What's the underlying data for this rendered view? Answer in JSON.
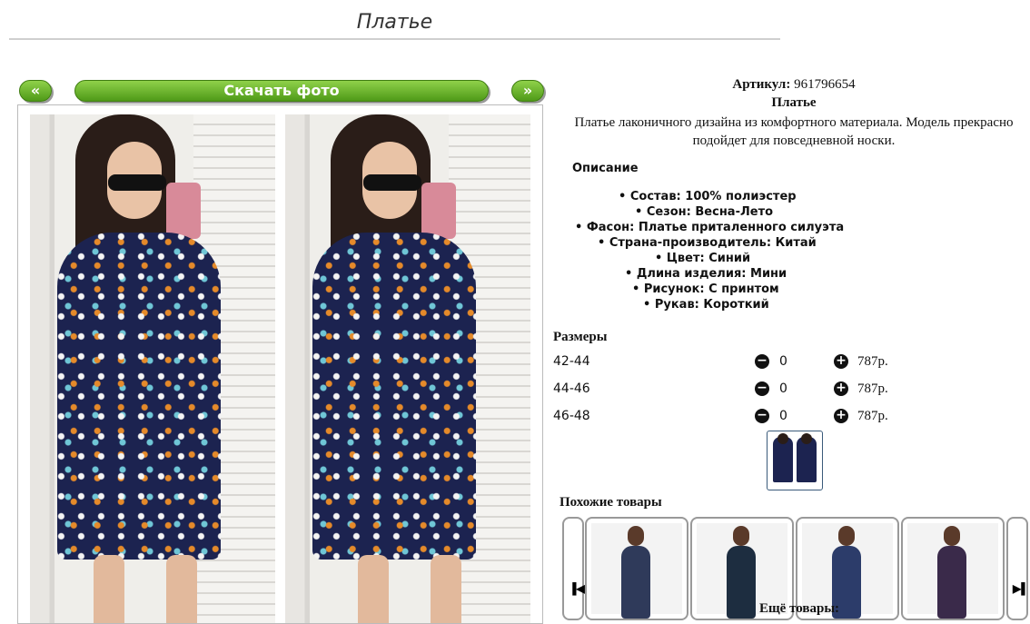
{
  "page": {
    "title": "Платье"
  },
  "gallery": {
    "prev": "«",
    "next": "»",
    "download": "Скачать фото"
  },
  "product": {
    "sku_label": "Артикул:",
    "sku": "961796654",
    "name": "Платье",
    "description": "Платье лаконичного дизайна из комфортного материала. Модель прекрасно подойдет для повседневной носки.",
    "desc_heading": "Описание",
    "properties": [
      "Состав: 100% полиэстер",
      "Сезон: Весна-Лето",
      "Фасон: Платье приталенного силуэта",
      "Страна-производитель: Китай",
      "Цвет: Синий",
      "Длина изделия: Мини",
      "Рисунок: С принтом",
      "Рукав: Короткий"
    ]
  },
  "sizes": {
    "heading": "Размеры",
    "rows": [
      {
        "size": "42-44",
        "qty": "0",
        "price": "787р."
      },
      {
        "size": "44-46",
        "qty": "0",
        "price": "787р."
      },
      {
        "size": "46-48",
        "qty": "0",
        "price": "787р."
      }
    ],
    "minus": "−",
    "plus": "+"
  },
  "similar": {
    "heading": "Похожие товары",
    "prev": "▐◀",
    "next": "▶▌",
    "colors": [
      "#2f3a5a",
      "#1d2d40",
      "#2c3c6a",
      "#3a2a4a"
    ]
  },
  "more": {
    "heading": "Ещё товары:"
  }
}
